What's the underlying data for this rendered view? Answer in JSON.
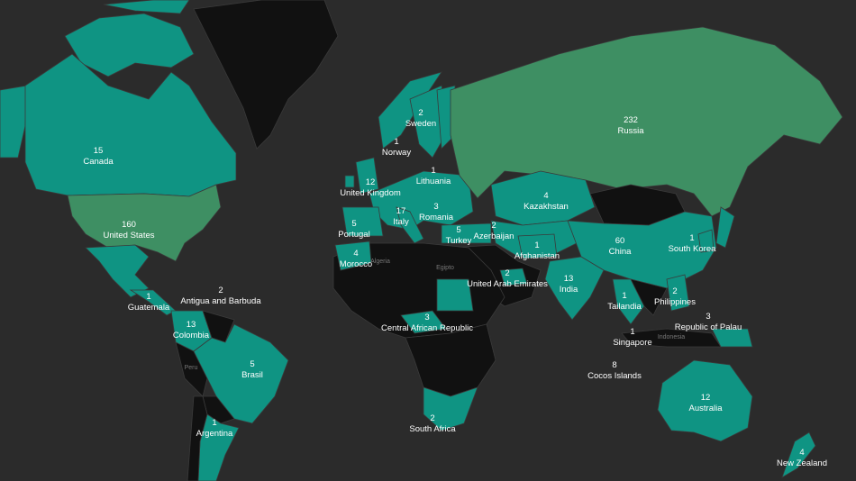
{
  "map": {
    "colors": {
      "background": "#2b2b2b",
      "teal": "#0f9483",
      "green": "#3e8f63",
      "no_data": "#111111"
    },
    "countries": [
      {
        "id": "russia",
        "name": "Russia",
        "count": "232"
      },
      {
        "id": "usa",
        "name": "United States",
        "count": "160"
      },
      {
        "id": "china",
        "name": "China",
        "count": "60"
      },
      {
        "id": "canada",
        "name": "Canada",
        "count": "15"
      },
      {
        "id": "colombia",
        "name": "Colombia",
        "count": "13"
      },
      {
        "id": "india",
        "name": "India",
        "count": "13"
      },
      {
        "id": "uk",
        "name": "United Kingdom",
        "count": "12"
      },
      {
        "id": "australia",
        "name": "Australia",
        "count": "12"
      },
      {
        "id": "italy",
        "name": "Italy",
        "count": "17"
      },
      {
        "id": "cocos",
        "name": "Cocos Islands",
        "count": "8"
      },
      {
        "id": "brasil",
        "name": "Brasil",
        "count": "5"
      },
      {
        "id": "portugal",
        "name": "Portugal",
        "count": "5"
      },
      {
        "id": "turkey",
        "name": "Turkey",
        "count": "5"
      },
      {
        "id": "kazakhstan",
        "name": "Kazakhstan",
        "count": "4"
      },
      {
        "id": "morocco",
        "name": "Morocco",
        "count": "4"
      },
      {
        "id": "newzealand",
        "name": "New Zealand",
        "count": "4"
      },
      {
        "id": "romania",
        "name": "Romania",
        "count": "3"
      },
      {
        "id": "car",
        "name": "Central African Republic",
        "count": "3"
      },
      {
        "id": "palau",
        "name": "Republic of Palau",
        "count": "3"
      },
      {
        "id": "sweden",
        "name": "Sweden",
        "count": "2"
      },
      {
        "id": "azerbaijan",
        "name": "Azerbaijan",
        "count": "2"
      },
      {
        "id": "uae",
        "name": "United Arab Emirates",
        "count": "2"
      },
      {
        "id": "antigua",
        "name": "Antigua and Barbuda",
        "count": "2"
      },
      {
        "id": "southafrica",
        "name": "South Africa",
        "count": "2"
      },
      {
        "id": "philippines",
        "name": "Philippines",
        "count": "2"
      },
      {
        "id": "norway",
        "name": "Norway",
        "count": "1"
      },
      {
        "id": "lithuania",
        "name": "Lithuania",
        "count": "1"
      },
      {
        "id": "afghanistan",
        "name": "Afghanistan",
        "count": "1"
      },
      {
        "id": "southkorea",
        "name": "South Korea",
        "count": "1"
      },
      {
        "id": "guatemala",
        "name": "Guatemala",
        "count": "1"
      },
      {
        "id": "argentina",
        "name": "Argentina",
        "count": "1"
      },
      {
        "id": "thailand",
        "name": "Tailandia",
        "count": "1"
      },
      {
        "id": "singapore",
        "name": "Singapore",
        "count": "1"
      }
    ],
    "base_labels": [
      {
        "id": "algeria",
        "text": "Algeria"
      },
      {
        "id": "egypt",
        "text": "Egipto"
      },
      {
        "id": "peru",
        "text": "Peru"
      },
      {
        "id": "indonesia",
        "text": "Indonesia"
      }
    ]
  }
}
